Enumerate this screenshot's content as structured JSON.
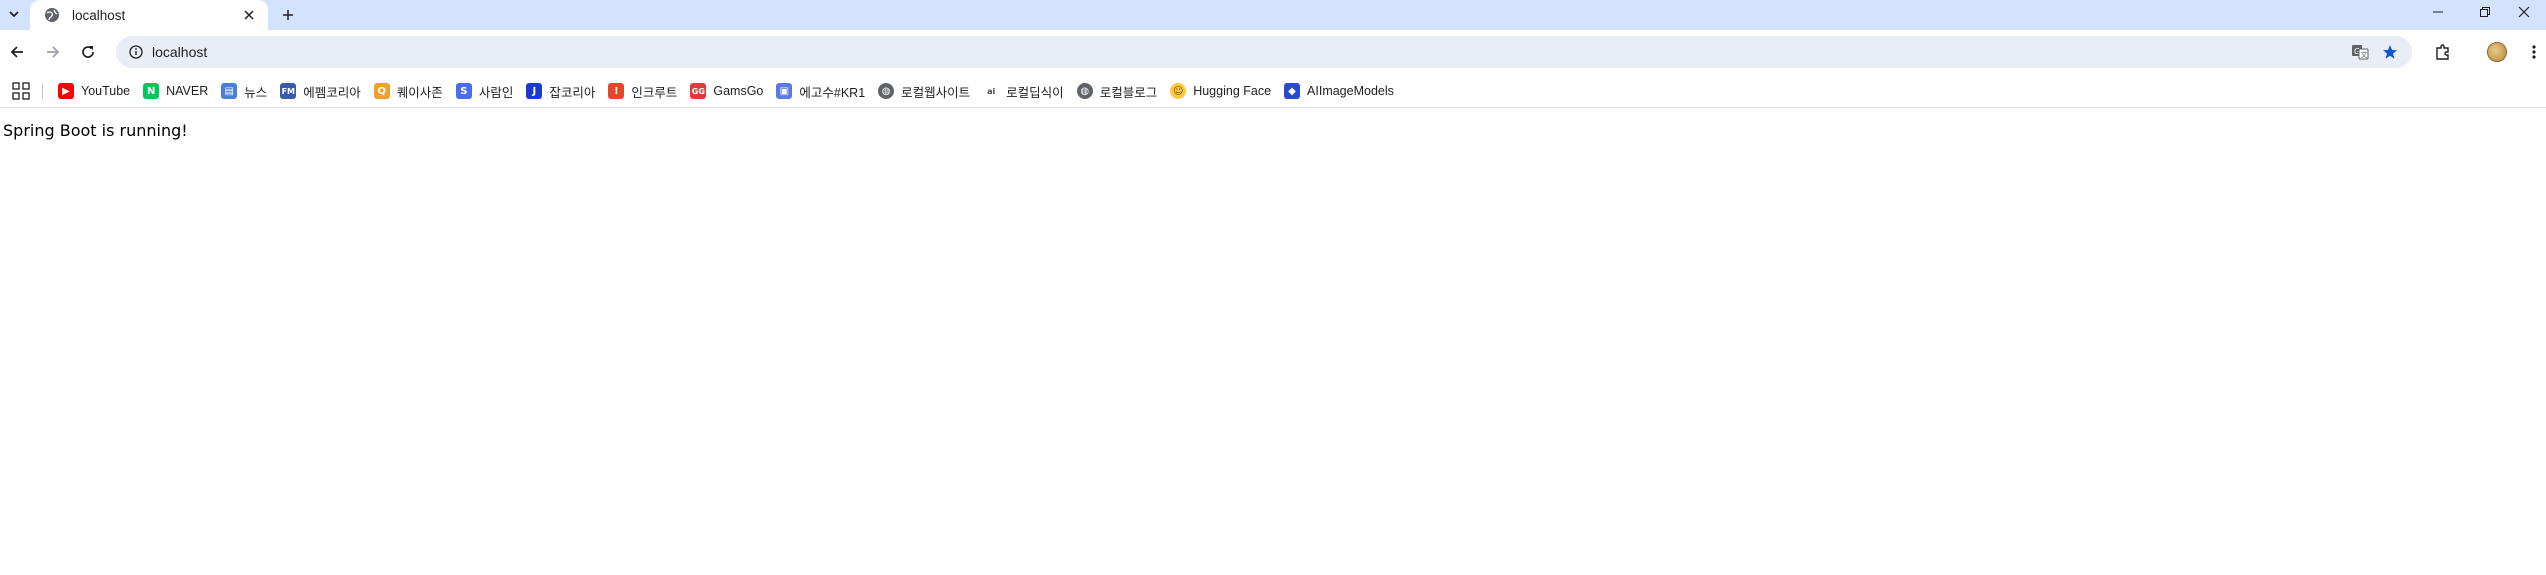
{
  "tabstrip": {
    "tab_title": "localhost"
  },
  "toolbar": {
    "url": "localhost"
  },
  "bookmarks": [
    {
      "label": "YouTube",
      "icon": "youtube-icon",
      "color": "#ff0000",
      "glyph": "▶"
    },
    {
      "label": "NAVER",
      "icon": "naver-icon",
      "color": "#03c75a",
      "glyph": "N"
    },
    {
      "label": "뉴스",
      "icon": "news-icon",
      "color": "#4a7fd8",
      "glyph": "▤"
    },
    {
      "label": "에펨코리아",
      "icon": "fmkorea-icon",
      "color": "#3a5ba8",
      "glyph": "FM"
    },
    {
      "label": "퀘이사존",
      "icon": "quasarzone-icon",
      "color": "#f0a030",
      "glyph": "Q"
    },
    {
      "label": "사람인",
      "icon": "saramin-icon",
      "color": "#4a6cf0",
      "glyph": "S"
    },
    {
      "label": "잡코리아",
      "icon": "jobkorea-icon",
      "color": "#1a3ad0",
      "glyph": "J"
    },
    {
      "label": "인크루트",
      "icon": "incruit-icon",
      "color": "#e04a2a",
      "glyph": "!"
    },
    {
      "label": "GamsGo",
      "icon": "gamsgo-icon",
      "color": "#e23a3a",
      "glyph": "GG"
    },
    {
      "label": "에고수#KR1",
      "icon": "opgg-icon",
      "color": "#5a7ae0",
      "glyph": "▣"
    },
    {
      "label": "로컬웹사이트",
      "icon": "globe-icon",
      "color": "#5f6368",
      "glyph": "◍"
    },
    {
      "label": "로컬딥식이",
      "icon": "ai-icon",
      "color": "#444444",
      "glyph": "ai"
    },
    {
      "label": "로컬블로그",
      "icon": "globe-icon",
      "color": "#5f6368",
      "glyph": "◍"
    },
    {
      "label": "Hugging Face",
      "icon": "huggingface-icon",
      "color": "#ffc83d",
      "glyph": "☺"
    },
    {
      "label": "AIImageModels",
      "icon": "aiimagemodels-icon",
      "color": "#2a4ad0",
      "glyph": "◆"
    }
  ],
  "page": {
    "body_text": "Spring Boot is running!"
  },
  "colors": {
    "tabstrip_bg": "#d3e3fd",
    "omnibox_bg": "#e9eef6",
    "star_accent": "#0b57d0"
  }
}
